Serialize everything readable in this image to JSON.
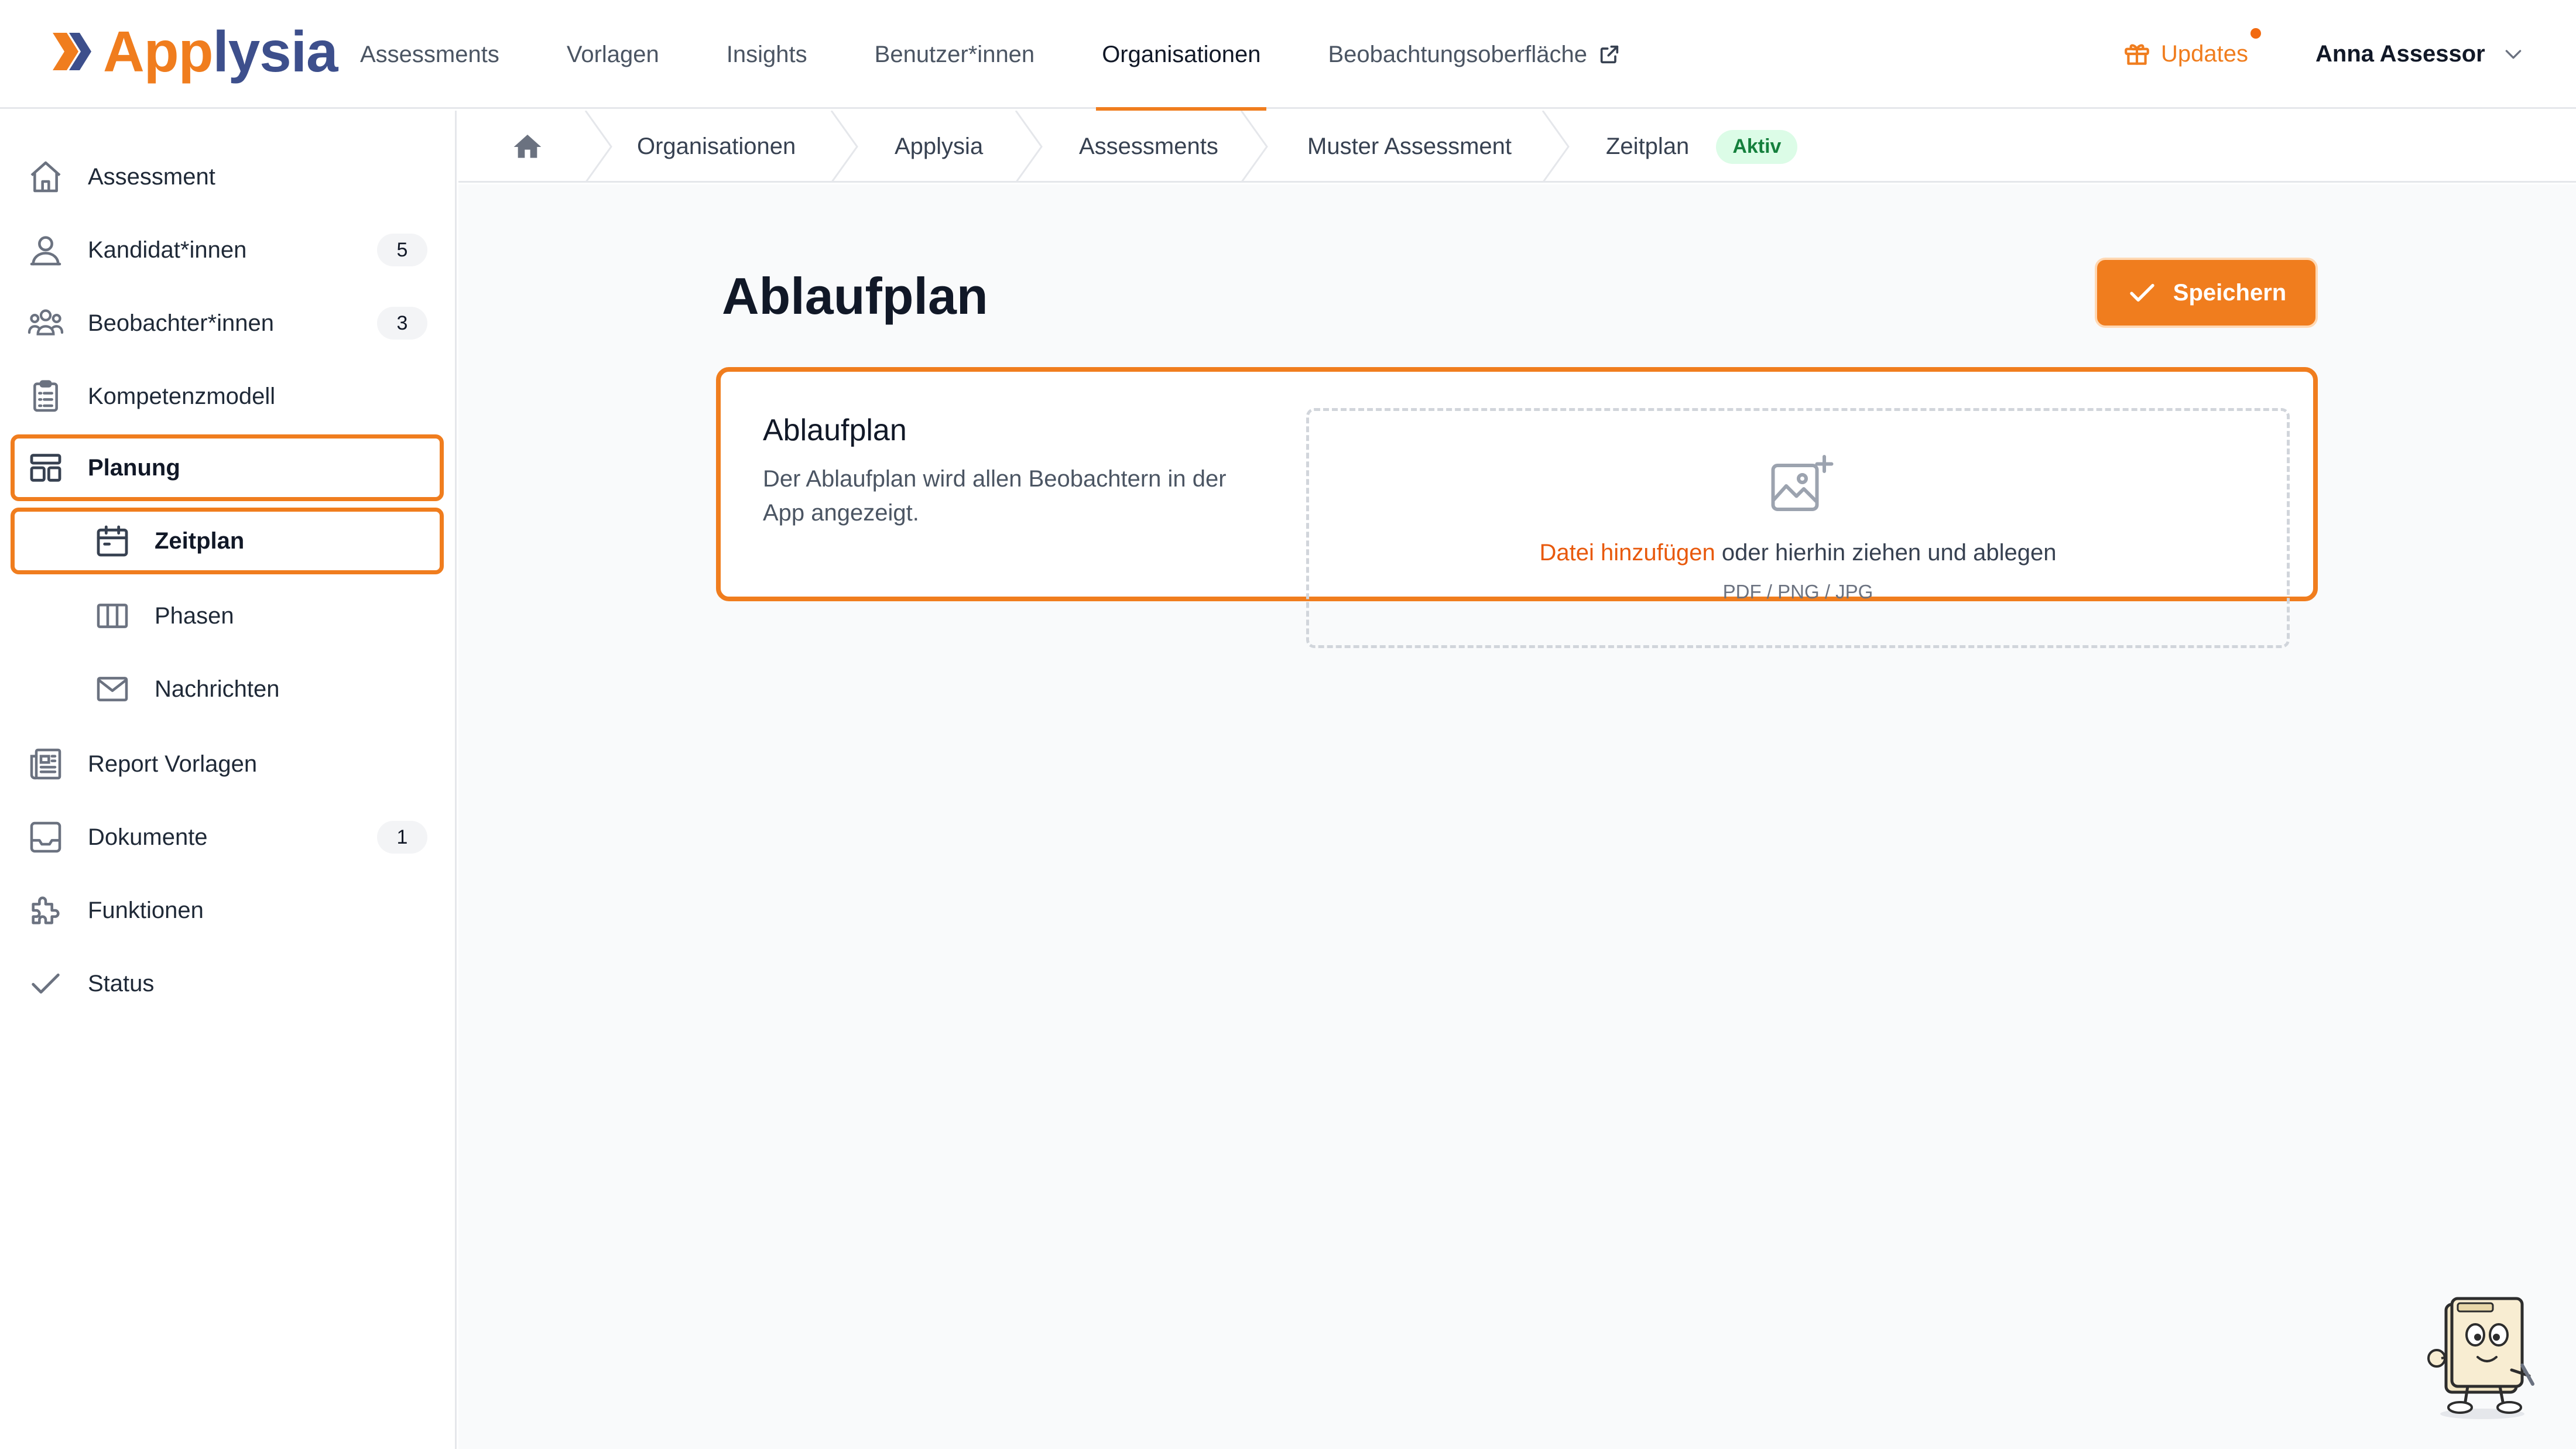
{
  "brand": {
    "name_part1": "App",
    "name_part2": "lysia",
    "accent_color": "#f07d1e",
    "secondary_color": "#3d4f8c"
  },
  "topnav": {
    "items": [
      {
        "label": "Assessments",
        "active": false
      },
      {
        "label": "Vorlagen",
        "active": false
      },
      {
        "label": "Insights",
        "active": false
      },
      {
        "label": "Benutzer*innen",
        "active": false
      },
      {
        "label": "Organisationen",
        "active": true
      },
      {
        "label": "Beobachtungsoberfläche",
        "active": false,
        "icon": "external-link-icon"
      }
    ],
    "updates_label": "Updates",
    "updates_has_notification": true,
    "user_name": "Anna Assessor"
  },
  "sidebar": {
    "items": [
      {
        "label": "Assessment",
        "icon": "home-icon"
      },
      {
        "label": "Kandidat*innen",
        "icon": "users-icon",
        "badge": "5"
      },
      {
        "label": "Beobachter*innen",
        "icon": "group-icon",
        "badge": "3"
      },
      {
        "label": "Kompetenzmodell",
        "icon": "clipboard-icon"
      },
      {
        "label": "Planung",
        "icon": "layout-icon",
        "highlighted": true
      },
      {
        "label": "Zeitplan",
        "icon": "calendar-icon",
        "highlighted": true,
        "sub": true
      },
      {
        "label": "Phasen",
        "icon": "columns-icon",
        "sub": true
      },
      {
        "label": "Nachrichten",
        "icon": "mail-icon",
        "sub": true
      },
      {
        "label": "Report Vorlagen",
        "icon": "report-icon"
      },
      {
        "label": "Dokumente",
        "icon": "inbox-icon",
        "badge": "1"
      },
      {
        "label": "Funktionen",
        "icon": "puzzle-icon"
      },
      {
        "label": "Status",
        "icon": "check-icon"
      }
    ]
  },
  "breadcrumb": {
    "items": [
      "Organisationen",
      "Applysia",
      "Assessments",
      "Muster Assessment",
      "Zeitplan"
    ],
    "status_badge": "Aktiv"
  },
  "main": {
    "title": "Ablaufplan",
    "save_label": "Speichern",
    "card": {
      "title": "Ablaufplan",
      "description": "Der Ablaufplan wird allen Beobachtern in der App angezeigt.",
      "dropzone": {
        "link_text": "Datei hinzufügen",
        "rest_text": " oder hierhin ziehen und ablegen",
        "file_types": "PDF / PNG / JPG"
      }
    }
  }
}
